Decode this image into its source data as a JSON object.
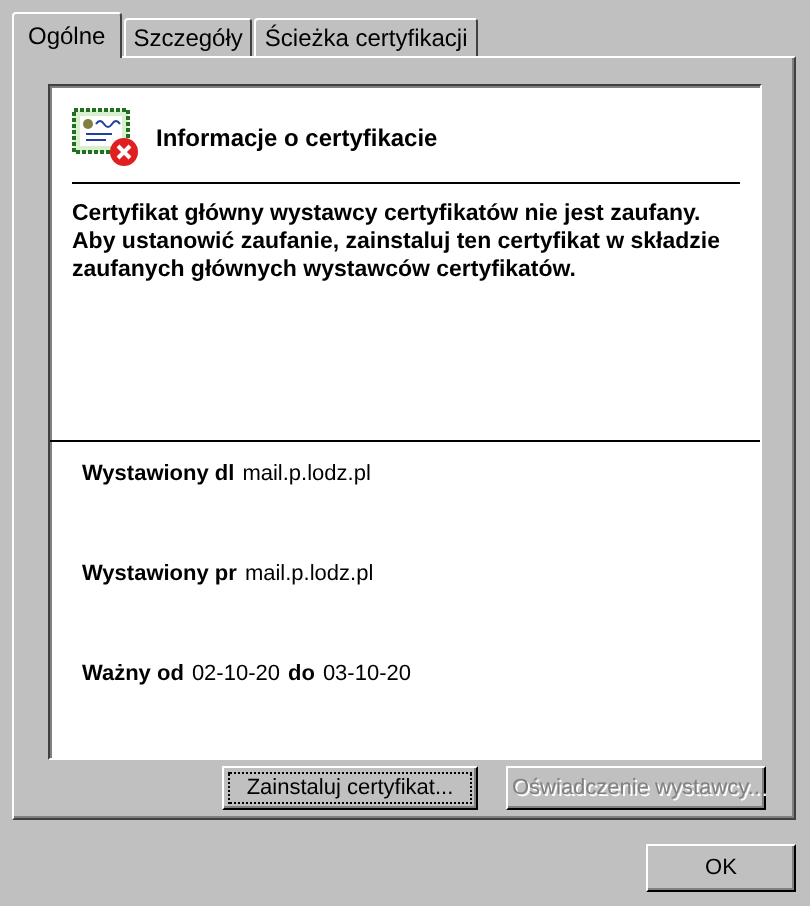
{
  "tabs": [
    {
      "label": "Ogólne",
      "selected": true
    },
    {
      "label": "Szczegóły",
      "selected": false
    },
    {
      "label": "Ścieżka certyfikacji",
      "selected": false
    }
  ],
  "info": {
    "title": "Informacje o certyfikacie",
    "message": "Certyfikat główny wystawcy certyfikatów nie jest zaufany. Aby ustanowić zaufanie, zainstaluj ten certyfikat w składzie zaufanych głównych wystawców certyfikatów.",
    "issued_to": {
      "label": "Wystawiony dl",
      "value": "mail.p.lodz.pl"
    },
    "issued_by": {
      "label": "Wystawiony pr",
      "value": "mail.p.lodz.pl"
    },
    "validity": {
      "from_label": "Ważny od",
      "from": "02-10-20",
      "to_label": "do",
      "to": "03-10-20"
    }
  },
  "panel_buttons": [
    {
      "label": "Zainstaluj certyfikat...",
      "disabled": false
    },
    {
      "label": "Oświadczenie wystawcy...",
      "disabled": true
    }
  ],
  "dialog_buttons": [
    {
      "label": "OK",
      "disabled": false
    }
  ]
}
